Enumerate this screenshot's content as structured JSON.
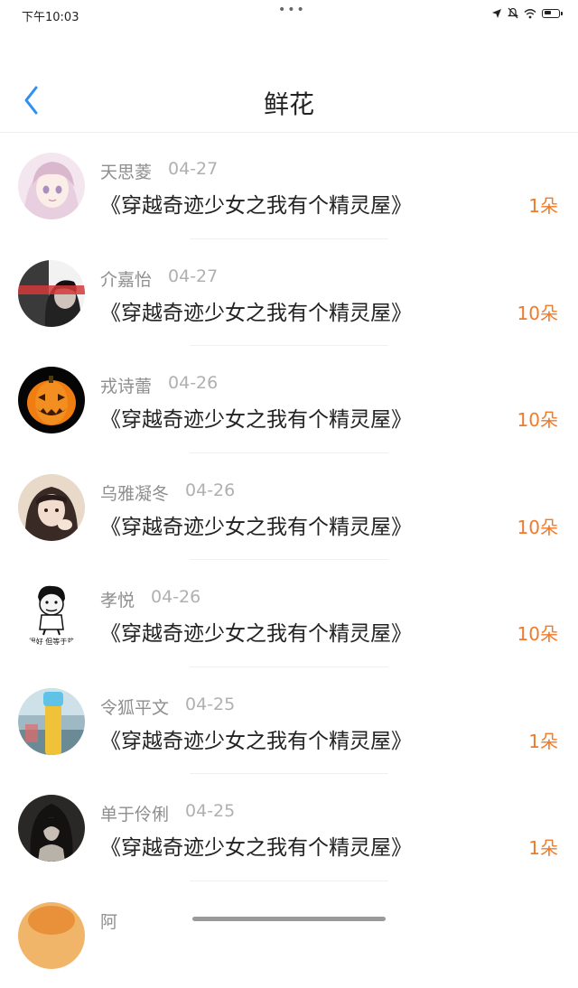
{
  "status_bar": {
    "time": "下午10:03",
    "dots": "•••"
  },
  "header": {
    "title": "鲜花"
  },
  "flowers": [
    {
      "name": "天思菱",
      "date": "04-27",
      "book": "《穿越奇迹少女之我有个精灵屋》",
      "count": "1朵",
      "avatar": "anime-girl-avatar"
    },
    {
      "name": "介嘉怡",
      "date": "04-27",
      "book": "《穿越奇迹少女之我有个精灵屋》",
      "count": "10朵",
      "avatar": "boy-avatar"
    },
    {
      "name": "戎诗蕾",
      "date": "04-26",
      "book": "《穿越奇迹少女之我有个精灵屋》",
      "count": "10朵",
      "avatar": "pumpkin-avatar"
    },
    {
      "name": "乌雅凝冬",
      "date": "04-26",
      "book": "《穿越奇迹少女之我有个精灵屋》",
      "count": "10朵",
      "avatar": "girl-avatar"
    },
    {
      "name": "孝悦",
      "date": "04-26",
      "book": "《穿越奇迹少女之我有个精灵屋》",
      "count": "10朵",
      "avatar": "meme-avatar",
      "avatar_text": "很好 但等于贫"
    },
    {
      "name": "令狐平文",
      "date": "04-25",
      "book": "《穿越奇迹少女之我有个精灵屋》",
      "count": "1朵",
      "avatar": "bottle-avatar"
    },
    {
      "name": "单于伶俐",
      "date": "04-25",
      "book": "《穿越奇迹少女之我有个精灵屋》",
      "count": "1朵",
      "avatar": "dark-hair-avatar"
    },
    {
      "name": "阿",
      "date": "",
      "book": "",
      "count": "",
      "avatar": "partial-avatar"
    }
  ],
  "colors": {
    "accent_blue": "#2f8ff0",
    "count_orange": "#f07a2a",
    "name_gray": "#8e8e8e",
    "date_gray": "#b0b0b0"
  }
}
